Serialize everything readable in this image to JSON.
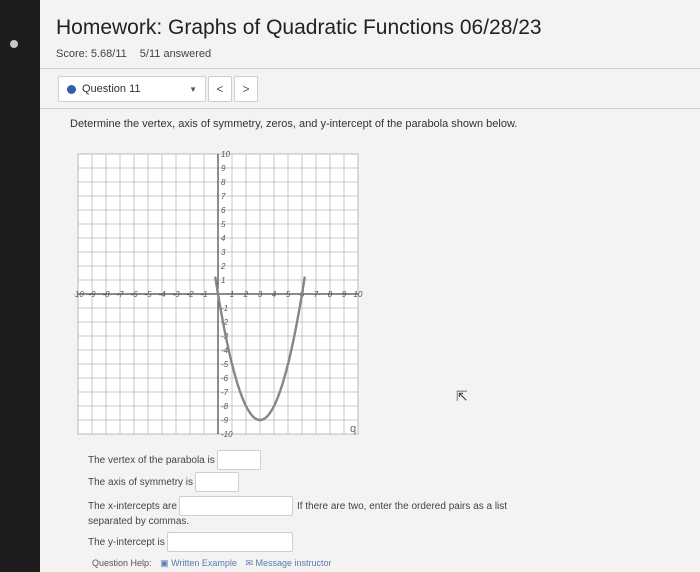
{
  "header": {
    "title": "Homework: Graphs of Quadratic Functions 06/28/23",
    "score": "Score: 5.68/11",
    "answered": "5/11 answered"
  },
  "question_nav": {
    "selected": "Question 11",
    "prev": "<",
    "next": ">"
  },
  "prompt": "Determine the vertex, axis of symmetry, zeros, and y-intercept of the parabola shown below.",
  "graph": {
    "x_ticks_neg": [
      "-10",
      "-9",
      "-8",
      "-7",
      "-6",
      "-5",
      "-4",
      "-3",
      "-2",
      "-1"
    ],
    "x_ticks_pos": [
      "1",
      "2",
      "3",
      "4",
      "5",
      "6",
      "7",
      "8",
      "9",
      "10"
    ],
    "y_ticks_pos": [
      "1",
      "2",
      "3",
      "4",
      "5",
      "6",
      "7",
      "8",
      "9",
      "10"
    ],
    "y_ticks_neg": [
      "-1",
      "-2",
      "-3",
      "-4",
      "-5",
      "-6",
      "-7",
      "-8",
      "-9",
      "-10"
    ],
    "colors": {
      "grid": "#b9b9b9",
      "curve": "#8a8580",
      "axis": "#444444"
    },
    "corner_mark": "q"
  },
  "answers": {
    "vertex_label": "The vertex of the parabola is",
    "axis_label": "The axis of symmetry is",
    "xint_label": "The x-intercepts are",
    "xint_note": "If there are two, enter the ordered pairs as a list",
    "xint_note2": "separated by commas.",
    "yint_label": "The y-intercept is"
  },
  "help": {
    "label": "Question Help:",
    "written_example": "Written Example",
    "message": "Message instructor"
  }
}
